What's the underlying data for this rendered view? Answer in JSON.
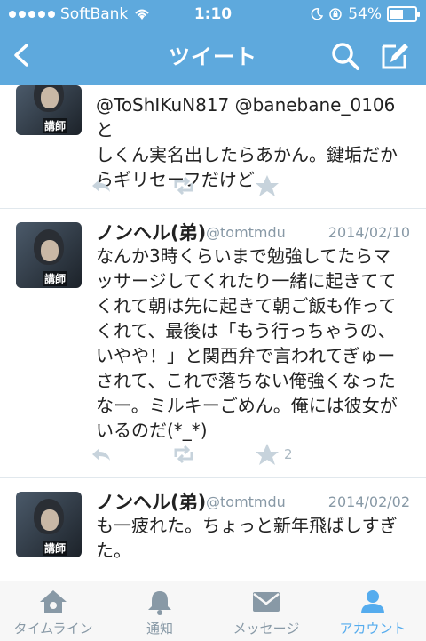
{
  "status": {
    "carrier": "SoftBank",
    "time": "1:10",
    "battery": "54%",
    "battery_level": 0.54
  },
  "nav": {
    "title": "ツイート"
  },
  "tweets": [
    {
      "text": "@ToShIKuN817 @banebane_0106 と\nしくん実名出したらあかん。鍵垢だか\nらギリセーフだけど",
      "avatar_tag": "講師",
      "retweets": "",
      "favorites": ""
    },
    {
      "name": "ノンヘル(弟)",
      "handle": "@tomtmdu",
      "date": "2014/02/10",
      "text": "なんか3時くらいまで勉強してたらマ\nッサージしてくれたり一緒に起きてて\nくれて朝は先に起きて朝ご飯も作って\nくれて、最後は「もう行っちゃうの、\nいやや！」と関西弁で言われてぎゅー\nされて、これで落ちない俺強くなった\nなー。ミルキーごめん。俺には彼女が\nいるのだ(*_*)",
      "avatar_tag": "講師",
      "favorites": "2"
    },
    {
      "name": "ノンヘル(弟)",
      "handle": "@tomtmdu",
      "date": "2014/02/02",
      "text": "も一疲れた。ちょっと新年飛ばしすぎ\nた。",
      "avatar_tag": "講師"
    }
  ],
  "tabs": [
    {
      "label": "タイムライン",
      "icon": "home-icon"
    },
    {
      "label": "通知",
      "icon": "bell-icon"
    },
    {
      "label": "メッセージ",
      "icon": "envelope-icon"
    },
    {
      "label": "アカウント",
      "icon": "person-icon",
      "active": true
    }
  ],
  "colors": {
    "brand": "#5ea9dd",
    "active_tab": "#55acee",
    "muted": "#8899a6"
  }
}
